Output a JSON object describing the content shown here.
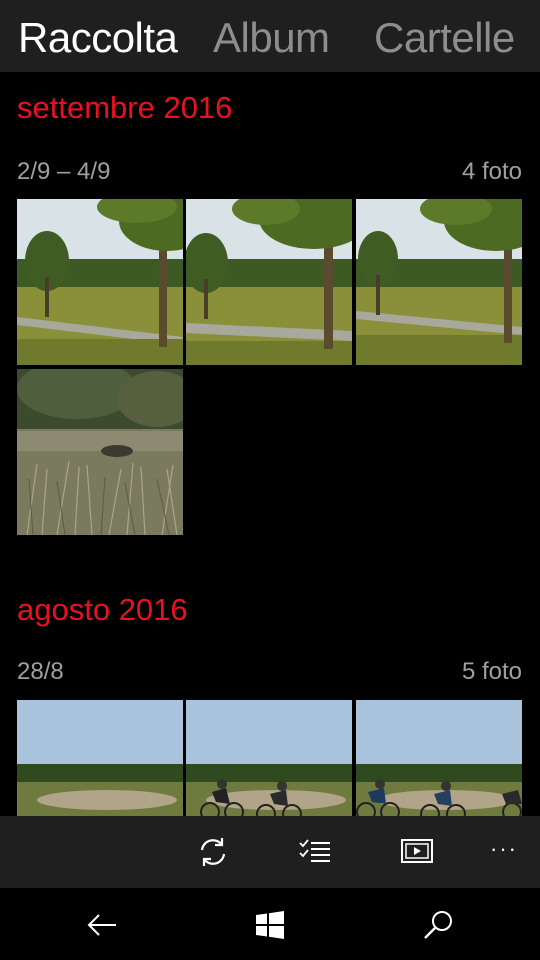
{
  "pivot": {
    "tabs": [
      {
        "label": "Raccolta"
      },
      {
        "label": "Album"
      },
      {
        "label": "Cartelle"
      }
    ],
    "active_tab": "Raccolta"
  },
  "sections": [
    {
      "month": "settembre 2016",
      "date_range": "2/9 – 4/9",
      "count": "4 foto"
    },
    {
      "month": "agosto 2016",
      "date_range": "28/8",
      "count": "5 foto"
    }
  ],
  "appbar": {
    "buttons": [
      {
        "icon": "sync-icon"
      },
      {
        "icon": "select-icon"
      },
      {
        "icon": "slideshow-icon"
      }
    ],
    "more_label": "···"
  },
  "navbar": {
    "buttons": [
      {
        "icon": "back-icon"
      },
      {
        "icon": "windows-start-icon"
      },
      {
        "icon": "search-icon"
      }
    ]
  },
  "colors": {
    "accent": "#e81123",
    "chrome": "#1f1f1f",
    "background": "#000000",
    "inactive_tab": "#8d8d8d",
    "secondary_text": "#a0a0a0"
  }
}
